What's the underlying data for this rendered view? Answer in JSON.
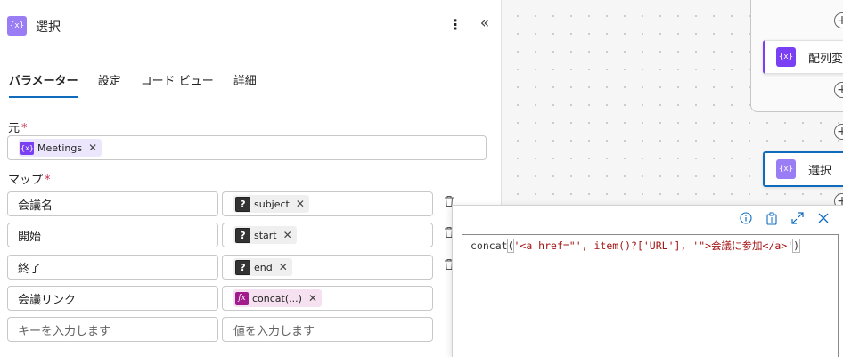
{
  "header": {
    "title": "選択",
    "icon": "variable-icon",
    "icon_glyph": "{x}"
  },
  "tabs": [
    "パラメーター",
    "設定",
    "コード ビュー",
    "詳細"
  ],
  "active_tab": "パラメーター",
  "source": {
    "label": "元",
    "required_mark": "*",
    "token": {
      "label": "Meetings",
      "icon_glyph": "{x}"
    }
  },
  "map": {
    "label": "マップ",
    "required_mark": "*",
    "rows": [
      {
        "key": "会議名",
        "value_token": "subject",
        "kind": "dynamic"
      },
      {
        "key": "開始",
        "value_token": "start",
        "kind": "dynamic"
      },
      {
        "key": "終了",
        "value_token": "end",
        "kind": "dynamic"
      },
      {
        "key": "会議リンク",
        "value_token": "concat(...)",
        "kind": "expression"
      }
    ],
    "key_placeholder": "キーを入力します",
    "value_placeholder": "値を入力します"
  },
  "token_remove_glyph": "✕",
  "canvas": {
    "cards": [
      {
        "label": "配列変数",
        "icon_glyph": "{x}"
      },
      {
        "label": "選択",
        "icon_glyph": "{x}"
      }
    ]
  },
  "expression_editor": {
    "fn": "concat",
    "open_paren": "(",
    "arg_text": "'<a href=\"', item()?['URL'], '\">会議に参加</a>'",
    "close_paren": ")"
  },
  "colors": {
    "accent": "#0f6cbd",
    "variable": "#7a3ff2",
    "expression": "#a21b8c"
  }
}
